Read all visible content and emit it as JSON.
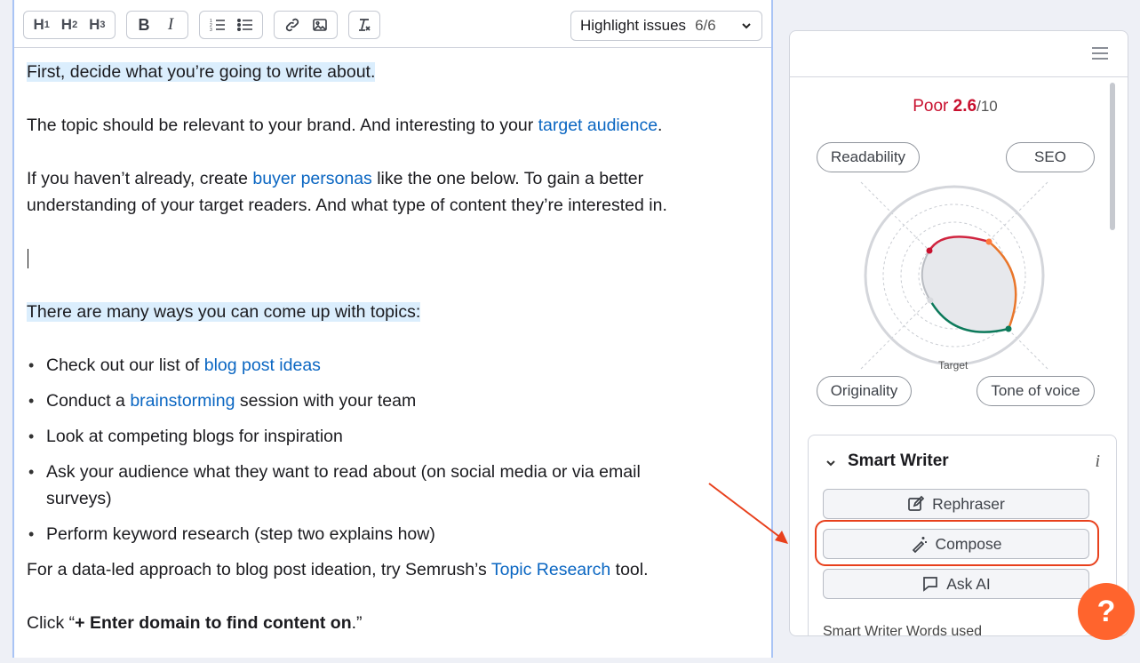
{
  "toolbar": {
    "h1": "H",
    "h1_sub": "1",
    "h2": "H",
    "h2_sub": "2",
    "h3": "H",
    "h3_sub": "3",
    "bold": "B",
    "italic": "I",
    "highlight_label": "Highlight issues",
    "highlight_count": "6/6"
  },
  "content": {
    "p1": "First, decide what you’re going to write about.",
    "p2_a": "The topic should be relevant to your brand. And interesting to your ",
    "p2_link": "target audience",
    "p2_b": ".",
    "p3_a": "If you haven’t already, create ",
    "p3_link": "buyer personas",
    "p3_b": " like the one below. To gain a better understanding of your target readers. And what type of content they’re interested in.",
    "p4": "There are many ways you can come up with topics:",
    "li1_a": "Check out our list of ",
    "li1_link": "blog post ideas",
    "li2_a": "Conduct a ",
    "li2_link": "brainstorming",
    "li2_b": " session with your team",
    "li3": "Look at competing blogs for inspiration",
    "li4": "Ask your audience what they want to read about (on social media or via email surveys)",
    "li5": "Perform keyword research (step two explains how)",
    "p5_a": "For a data-led approach to blog post ideation, try Semrush’s ",
    "p5_link": "Topic Research",
    "p5_b": " tool.",
    "p6_a": "Click “",
    "p6_bold": "+ Enter domain to find content on",
    "p6_b": ".”"
  },
  "panel": {
    "score_label": "Poor",
    "score_value": "2.6",
    "score_den": "/10",
    "readability": "Readability",
    "seo": "SEO",
    "originality": "Originality",
    "tone": "Tone of voice",
    "target": "Target"
  },
  "smart_writer": {
    "title": "Smart Writer",
    "info": "i",
    "rephraser": "Rephraser",
    "compose": "Compose",
    "ask_ai": "Ask AI",
    "words_used": "Smart Writer Words used"
  },
  "help": "?",
  "colors": {
    "accent_orange": "#ff642d",
    "annotation_red": "#e8401c",
    "link_blue": "#0a66c2",
    "score_red": "#c8102e",
    "highlight_bg": "#dbeefd"
  }
}
